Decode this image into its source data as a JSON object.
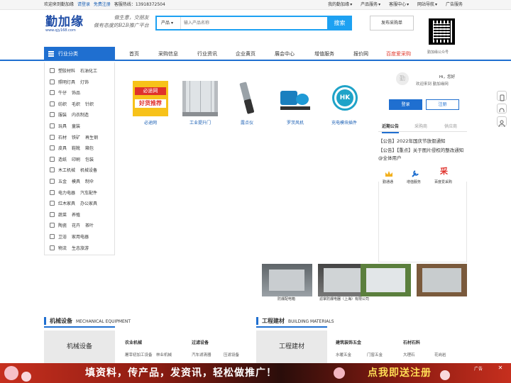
{
  "topbar": {
    "welcome": "欢迎来到勤加缘",
    "login": "请登录",
    "register": "免费注册",
    "hotline": "客服热线：13918372504",
    "links": [
      "我的勤加缘",
      "产品服务",
      "客服中心",
      "网站导航",
      "广告服务"
    ]
  },
  "header": {
    "logo_text": "勤加缘",
    "logo_url": "www.qjy168.com",
    "slogan_line1": "做生意，交朋友",
    "slogan_line2": "做有态度的B2B推广平台",
    "search_category": "产品",
    "search_placeholder": "输入产品名称",
    "search_button": "搜索",
    "post_button": "发布采购单",
    "qr_label": "勤加缘公众号"
  },
  "nav": {
    "category_title": "行业分类",
    "items": [
      "首页",
      "采购信息",
      "行业资讯",
      "企业黄页",
      "展会中心",
      "增值服务",
      "报价网",
      "百度爱采购"
    ],
    "accent": "#1f6fd0",
    "highlight": "#e03a2d"
  },
  "sidebar": {
    "rows": [
      [
        "塑胶材料",
        "石油化工"
      ],
      [
        "照明灯具",
        "灯饰"
      ],
      [
        "牛仔",
        "饰品"
      ],
      [
        "纺织",
        "毛织",
        "针织"
      ],
      [
        "服装",
        "内衣制造"
      ],
      [
        "玩具",
        "童装"
      ],
      [
        "石材",
        "铁矿",
        "再生钢"
      ],
      [
        "皮具",
        "鞋靴",
        "箱包"
      ],
      [
        "造纸",
        "印刷",
        "包装"
      ],
      [
        "木工机械",
        "机械设备"
      ],
      [
        "五金",
        "模具",
        "制伞"
      ],
      [
        "电力电器",
        "汽车配件"
      ],
      [
        "红木家具",
        "办公家具"
      ],
      [
        "蔬菜",
        "养殖"
      ],
      [
        "陶瓷",
        "花卉",
        "茶叶"
      ],
      [
        "卫浴",
        "家用电器"
      ],
      [
        "物流",
        "生态旅游"
      ]
    ]
  },
  "products": [
    {
      "caption": "必途网",
      "badge_top": "必途网",
      "badge_bottom": "好货推荐"
    },
    {
      "caption": "工业提升门"
    },
    {
      "caption": "露点仪"
    },
    {
      "caption": "罗茨风机"
    },
    {
      "caption": "充电模块插件",
      "badge": "HK"
    }
  ],
  "user": {
    "avatar_text": "勤",
    "hello": "Hi，您好",
    "welcome": "欢迎来到 勤加缘网",
    "login_button": "登录",
    "register_button": "注册"
  },
  "notices": {
    "tabs": [
      "近期公告",
      "采购商",
      "供应商"
    ],
    "items": [
      "【公告】2022年国庆节放假通知",
      "【公告】【重点】关于图片侵权的整改通知@全体用户"
    ]
  },
  "quick_links": [
    {
      "icon": "crown-icon",
      "label": "勤通通"
    },
    {
      "icon": "wrench-icon",
      "label": "增值服务"
    },
    {
      "icon": "baidu-icon",
      "label": "百度爱采购",
      "glyph": "采"
    }
  ],
  "ads": {
    "thumb_captions": [
      "防爆配电箱",
      "滤掌防爆电器（上海）有限公司"
    ]
  },
  "sections": [
    {
      "title": "机械设备",
      "en": "MECHANICAL EQUIPMENT",
      "box": "机械设备",
      "groups": [
        {
          "title": "农业机械",
          "items": [
            "屠宰初加工设备",
            "林业机械"
          ]
        },
        {
          "title": "过滤设备",
          "items": [
            "汽车滤清器",
            "压滤设备"
          ]
        }
      ]
    },
    {
      "title": "工程建材",
      "en": "BUILDING MATERIALS",
      "box": "工程建材",
      "groups": [
        {
          "title": "建筑装饰五金",
          "items": [
            "水暖五金",
            "门窗五金"
          ]
        },
        {
          "title": "石材石料",
          "items": [
            "大理石",
            "花岗岩"
          ]
        }
      ]
    }
  ],
  "banner": {
    "text": "填资料，传产品，发资讯，轻松做推广！",
    "cta": "点我即送注册",
    "ad_label": "广告",
    "close": "✕"
  }
}
